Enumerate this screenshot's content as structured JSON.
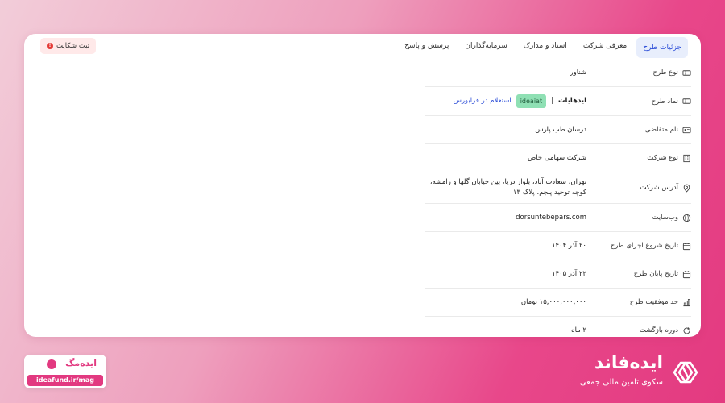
{
  "tabs": [
    {
      "label": "جزئیات طرح",
      "active": true
    },
    {
      "label": "معرفی شرکت",
      "active": false
    },
    {
      "label": "اسناد و مدارک",
      "active": false
    },
    {
      "label": "سرمایه‌گذاران",
      "active": false
    },
    {
      "label": "پرسش و پاسخ",
      "active": false
    }
  ],
  "complaint_button": {
    "label": "ثبت شکایت",
    "icon": "warning-icon"
  },
  "details": [
    {
      "label": "نوع طرح",
      "value": "شناور",
      "icon": "ticket-icon"
    },
    {
      "label": "نماد طرح",
      "value_prefix": "ایدهایات",
      "separator": "|",
      "badge": "ideaiat",
      "link": "استعلام در فرابورس",
      "icon": "ticket-icon"
    },
    {
      "label": "نام متقاضی",
      "value": "درسان طب پارس",
      "icon": "id-card-icon"
    },
    {
      "label": "نوع شرکت",
      "value": "شرکت سهامی خاص",
      "icon": "building-icon"
    },
    {
      "label": "آدرس شرکت",
      "value": "تهران، سعادت آباد، بلوار دریا، بین خیابان گلها و رامشه، کوچه توحید پنجم، پلاک ۱۳",
      "icon": "location-icon"
    },
    {
      "label": "وب‌سایت",
      "value": "dorsuntebepars.com",
      "icon": "globe-icon"
    },
    {
      "label": "تاریخ شروع اجرای طرح",
      "value": "۲۰ آذر ۱۴۰۴",
      "icon": "calendar-icon"
    },
    {
      "label": "تاریخ پایان طرح",
      "value": "۲۲ آذر ۱۴۰۵",
      "icon": "calendar-icon"
    },
    {
      "label": "حد موفقیت طرح",
      "value": "۱۵,۰۰۰,۰۰۰,۰۰۰ تومان",
      "icon": "chart-icon"
    },
    {
      "label": "دوره بازگشت",
      "value": "۲ ماه",
      "icon": "refresh-icon"
    }
  ],
  "mag": {
    "title": "ایده‌مگ",
    "url": "ideafund.ir/mag"
  },
  "brand": {
    "name": "ایده‌فاند",
    "tagline": "سکوی تامین مالی جمعی"
  },
  "colors": {
    "accent": "#e23980",
    "tab_active": "#2e4fd8",
    "badge": "#8fe0b4"
  }
}
